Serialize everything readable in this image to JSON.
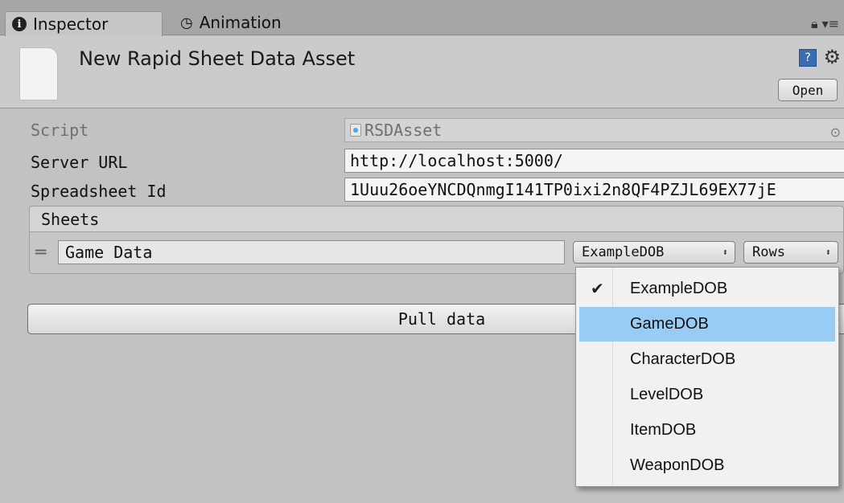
{
  "tabs": [
    {
      "label": "Inspector",
      "active": true
    },
    {
      "label": "Animation",
      "active": false
    }
  ],
  "header": {
    "title": "New Rapid Sheet Data Asset",
    "open_label": "Open"
  },
  "properties": {
    "script": {
      "label": "Script",
      "value": "RSDAsset"
    },
    "server_url": {
      "label": "Server URL",
      "value": "http://localhost:5000/"
    },
    "spreadsheet_id": {
      "label": "Spreadsheet Id",
      "value": "1Uuu26oeYNCDQnmgI141TP0ixi2n8QF4PZJL69EX77jE"
    }
  },
  "sheets": {
    "title": "Sheets",
    "items": [
      {
        "name": "Game Data",
        "type": "ExampleDOB",
        "mode": "Rows"
      }
    ]
  },
  "pull_button": {
    "label": "Pull data"
  },
  "dropdown": {
    "selected": "ExampleDOB",
    "highlighted": "GameDOB",
    "options": [
      "ExampleDOB",
      "GameDOB",
      "CharacterDOB",
      "LevelDOB",
      "ItemDOB",
      "WeaponDOB"
    ]
  },
  "colors": {
    "highlight": "#99ccf5",
    "panel": "#c2c2c2"
  },
  "icons": {
    "inspector": "info-icon",
    "animation": "clock-icon",
    "lock": "lock-icon",
    "menu": "menu-icon",
    "help": "help-icon",
    "gear": "gear-icon"
  }
}
